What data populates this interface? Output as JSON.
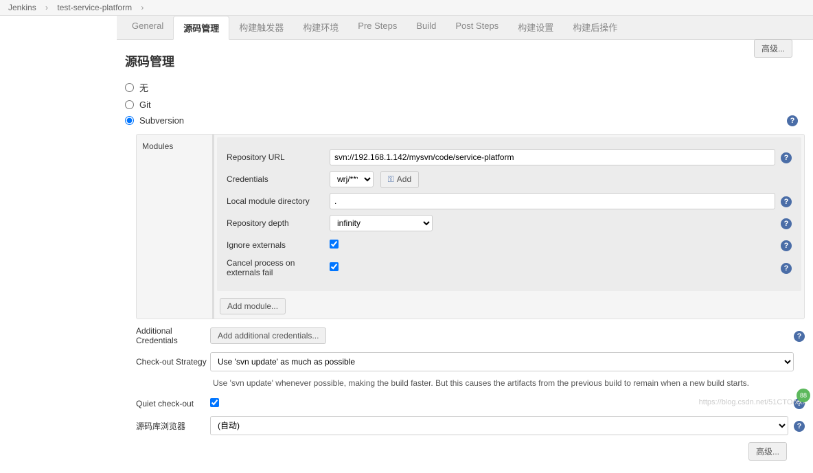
{
  "breadcrumb": {
    "root": "Jenkins",
    "project": "test-service-platform"
  },
  "tabs": [
    "General",
    "源码管理",
    "构建触发器",
    "构建环境",
    "Pre Steps",
    "Build",
    "Post Steps",
    "构建设置",
    "构建后操作"
  ],
  "active_tab": 1,
  "advanced_btn": "高级...",
  "section_title": "源码管理",
  "scm_options": {
    "none": "无",
    "git": "Git",
    "svn": "Subversion"
  },
  "modules": {
    "label": "Modules",
    "repo_url_label": "Repository URL",
    "repo_url_value": "svn://192.168.1.142/mysvn/code/service-platform",
    "credentials_label": "Credentials",
    "credentials_value": "wrj/******",
    "add_cred_btn": "Add",
    "local_dir_label": "Local module directory",
    "local_dir_value": ".",
    "depth_label": "Repository depth",
    "depth_value": "infinity",
    "ignore_ext_label": "Ignore externals",
    "cancel_ext_label": "Cancel process on externals fail",
    "add_module_btn": "Add module..."
  },
  "additional_credentials": {
    "label": "Additional Credentials",
    "btn": "Add additional credentials..."
  },
  "checkout_strategy": {
    "label": "Check-out Strategy",
    "value": "Use 'svn update' as much as possible",
    "desc": "Use 'svn update' whenever possible, making the build faster. But this causes the artifacts from the previous build to remain when a new build starts."
  },
  "quiet_checkout_label": "Quiet check-out",
  "repo_browser": {
    "label": "源码库浏览器",
    "value": "(自动)"
  },
  "watermark": "https://blog.csdn.net/51CTO/xxx",
  "badge": "88"
}
